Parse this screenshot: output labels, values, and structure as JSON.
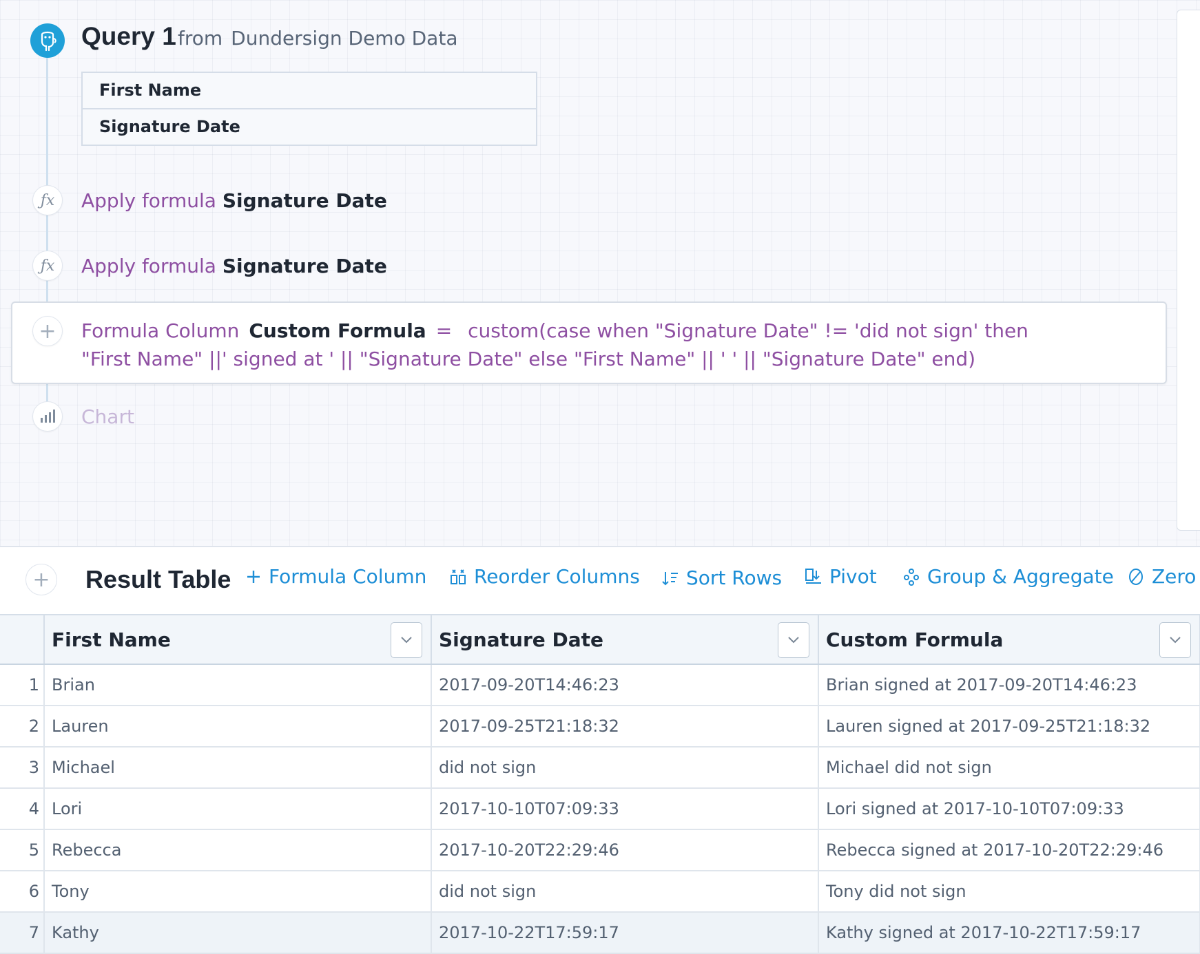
{
  "query": {
    "title": "Query 1",
    "from_label": "from",
    "source": "Dundersign Demo Data",
    "fields": [
      "First Name",
      "Signature Date"
    ]
  },
  "steps": [
    {
      "action": "Apply formula",
      "target": "Signature Date"
    },
    {
      "action": "Apply formula",
      "target": "Signature Date"
    }
  ],
  "formula_step": {
    "label": "Formula Column",
    "column_name": "Custom Formula",
    "equals": "=",
    "expression": "custom(case when \"Signature Date\" != 'did not sign' then \"First Name\" ||' signed at ' || \"Signature Date\" else \"First Name\" || ' ' || \"Signature Date\" end)"
  },
  "chart_step": {
    "label": "Chart"
  },
  "result": {
    "title": "Result Table",
    "tools": {
      "formula_column": "Formula Column",
      "reorder_columns": "Reorder Columns",
      "sort_rows": "Sort Rows",
      "pivot": "Pivot",
      "group_aggregate": "Group & Aggregate",
      "zero": "Zero"
    },
    "columns": [
      "First Name",
      "Signature Date",
      "Custom Formula"
    ],
    "rows": [
      {
        "index": "1",
        "first_name": "Brian",
        "signature_date": "2017-09-20T14:46:23",
        "custom_formula": "Brian signed at 2017-09-20T14:46:23"
      },
      {
        "index": "2",
        "first_name": "Lauren",
        "signature_date": "2017-09-25T21:18:32",
        "custom_formula": "Lauren signed at 2017-09-25T21:18:32"
      },
      {
        "index": "3",
        "first_name": "Michael",
        "signature_date": "did not sign",
        "custom_formula": "Michael did not sign"
      },
      {
        "index": "4",
        "first_name": "Lori",
        "signature_date": "2017-10-10T07:09:33",
        "custom_formula": "Lori signed at 2017-10-10T07:09:33"
      },
      {
        "index": "5",
        "first_name": "Rebecca",
        "signature_date": "2017-10-20T22:29:46",
        "custom_formula": "Rebecca signed at 2017-10-20T22:29:46"
      },
      {
        "index": "6",
        "first_name": "Tony",
        "signature_date": "did not sign",
        "custom_formula": "Tony did not sign"
      },
      {
        "index": "7",
        "first_name": "Kathy",
        "signature_date": "2017-10-22T17:59:17",
        "custom_formula": "Kathy signed at 2017-10-22T17:59:17"
      }
    ]
  },
  "colors": {
    "accent_blue": "#1d8ed6",
    "formula_purple": "#8e4fa2",
    "database_icon": "#1fa0d8"
  }
}
